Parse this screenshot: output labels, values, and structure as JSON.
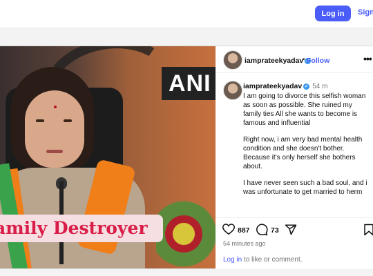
{
  "topbar": {
    "login_label": "Log in",
    "signup_label": "Sign"
  },
  "post": {
    "image": {
      "overlay_caption": "amily Destroyer",
      "watermark": "ANI"
    },
    "author": {
      "username": "iamprateekyadav",
      "verified": true,
      "follow_label": "Follow",
      "separator": "•"
    },
    "comment": {
      "username": "iamprateekyadav",
      "time": "54 m",
      "paragraphs": [
        "I am going to divorce this selfish woman as soon as possible. She ruined my family ties All she wants to become is famous and influential",
        "Right now, i am very bad mental health condition and she doesn't bother. Because it's only herself she bothers about.",
        "I have never seen such a bad soul, and i was unfortunate to get married to herm"
      ]
    },
    "stats": {
      "likes": "887",
      "comments": "73"
    },
    "posted_ago": "54 minutes ago",
    "login_prompt": {
      "link": "Log in",
      "rest": " to like or comment."
    }
  },
  "colors": {
    "accent": "#4a5df9",
    "caption_text": "#d91d48",
    "caption_bg": "#f6dfe2"
  }
}
